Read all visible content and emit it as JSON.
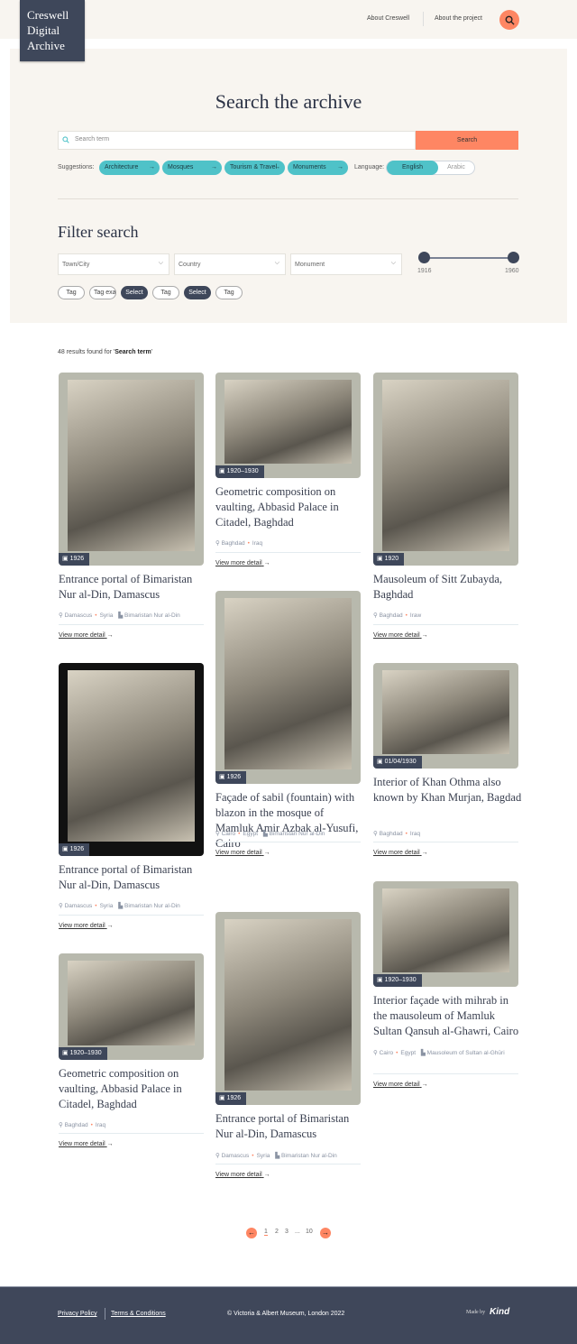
{
  "header": {
    "logo": "Creswell Digital Archive",
    "nav": [
      "About Creswell",
      "About the project"
    ],
    "search_icon": "search-icon"
  },
  "search": {
    "title": "Search the archive",
    "placeholder": "Search term",
    "button": "Search",
    "suggestions_label": "Suggestions:",
    "suggestions": [
      "Architecture",
      "Mosques",
      "Tourism & Travel",
      "Monuments"
    ],
    "language_label": "Language:",
    "languages": [
      "English",
      "Arabic"
    ],
    "selected_language": "English"
  },
  "filter": {
    "title": "Filter search",
    "selects": [
      "Town/City",
      "Country",
      "Monument"
    ],
    "year_min": "1916",
    "year_max": "1960",
    "range": [
      1916,
      1960
    ],
    "tags": [
      "Tag",
      "Tag example",
      "Select",
      "Tag",
      "Select",
      "Tag"
    ]
  },
  "results": {
    "prefix": "48 results found for '",
    "term": "Search term",
    "suffix": "'"
  },
  "cards": [
    {
      "date": "1926",
      "title": "Entrance portal of Bimaristan Nur al-Din, Damascus",
      "city": "Damascus",
      "country": "Syria",
      "monument": "Bimaristan Nur al-Din",
      "link": "View more detail"
    },
    {
      "date": "1926",
      "title": "Entrance portal of Bimaristan Nur al-Din, Damascus",
      "city": "Damascus",
      "country": "Syria",
      "monument": "Bimaristan Nur al-Din",
      "link": "View more detail"
    },
    {
      "date": "1920–1930",
      "title": "Geometric composition on vaulting, Abbasid Palace in Citadel, Baghdad",
      "city": "Baghdad",
      "country": "Iraq",
      "link": "View more detail"
    },
    {
      "date": "1920–1930",
      "title": "Geometric composition on vaulting, Abbasid Palace in Citadel, Baghdad",
      "city": "Baghdad",
      "country": "Iraq",
      "link": "View more detail"
    },
    {
      "date": "1926",
      "title": "Façade of sabil (fountain) with blazon in the mosque of Mamluk Amir Azbak al-Yusufi, Cairo",
      "city": "Cairo",
      "country": "Egypt",
      "monument": "Bimaristan Nur al-Din",
      "link": "View more detail"
    },
    {
      "date": "1926",
      "title": "Entrance portal of Bimaristan Nur al-Din, Damascus",
      "city": "Damascus",
      "country": "Syria",
      "monument": "Bimaristan Nur al-Din",
      "link": "View more detail"
    },
    {
      "date": "1920",
      "title": "Mausoleum of Sitt Zubayda, Baghdad",
      "city": "Baghdad",
      "country": "Iraw",
      "link": "View more detail"
    },
    {
      "date": "01/04/1930",
      "title": "Interior of Khan Othma also known by Khan Murjan, Bagdad",
      "city": "Baghdad",
      "country": "Iraq",
      "link": "View more detail"
    },
    {
      "date": "1920–1930",
      "title": "Interior façade with mihrab in the mausoleum of Mamluk Sultan Qansuh al-Ghawri, Cairo",
      "city": "Cairo",
      "country": "Egypt",
      "monument": "Mausoleum of Sultan al-Ghūri",
      "link": "View more detail"
    }
  ],
  "pagination": {
    "pages": [
      "1",
      "2",
      "3",
      "...",
      "10"
    ],
    "current": "1"
  },
  "footer": {
    "privacy": "Privacy Policy",
    "terms": "Terms & Conditions",
    "copyright": "© Victoria & Albert Museum, London 2022",
    "made_by": "Made by",
    "brand": "Kind"
  },
  "colors": {
    "accent": "#fe8663",
    "teal": "#4fc2c8",
    "navy": "#3e475a",
    "cream": "#f8f5f0"
  }
}
